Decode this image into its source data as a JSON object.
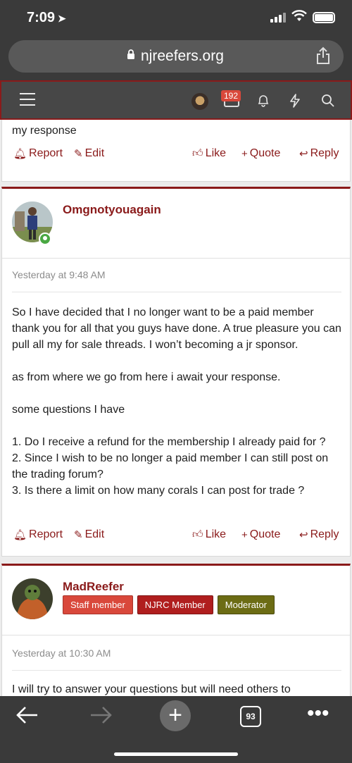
{
  "status": {
    "time": "7:09"
  },
  "browser": {
    "domain": "njreefers.org",
    "tab_count": "93"
  },
  "sitenav": {
    "notification_count": "192"
  },
  "post0": {
    "tail_text": "my response",
    "actions": {
      "report": "Report",
      "edit": "Edit",
      "like": "Like",
      "quote": "Quote",
      "reply": "Reply"
    }
  },
  "post1": {
    "username": "Omgnotyouagain",
    "date": "Yesterday at 9:48 AM",
    "body": "So I have decided that I no longer want to be a paid member thank you for all that you guys have done. A true pleasure you can pull all my for sale threads. I won’t becoming a jr sponsor.\n\nas from where we go from here i await your response.\n\nsome questions I have\n\n1. Do I receive a refund for the membership I already paid for ?\n2. Since I wish to be no longer a paid member I can still post on the trading forum?\n3. Is there a limit on how many corals I can post for trade ?",
    "actions": {
      "report": "Report",
      "edit": "Edit",
      "like": "Like",
      "quote": "Quote",
      "reply": "Reply"
    }
  },
  "post2": {
    "username": "MadReefer",
    "badges": {
      "staff": "Staff member",
      "njrc": "NJRC Member",
      "mod": "Moderator"
    },
    "date": "Yesterday at 10:30 AM",
    "body": "I will try to answer your questions but will need others to"
  },
  "colors": {
    "accent": "#8a1a1a",
    "chrome": "#3a3a3a",
    "nav": "#474747"
  }
}
